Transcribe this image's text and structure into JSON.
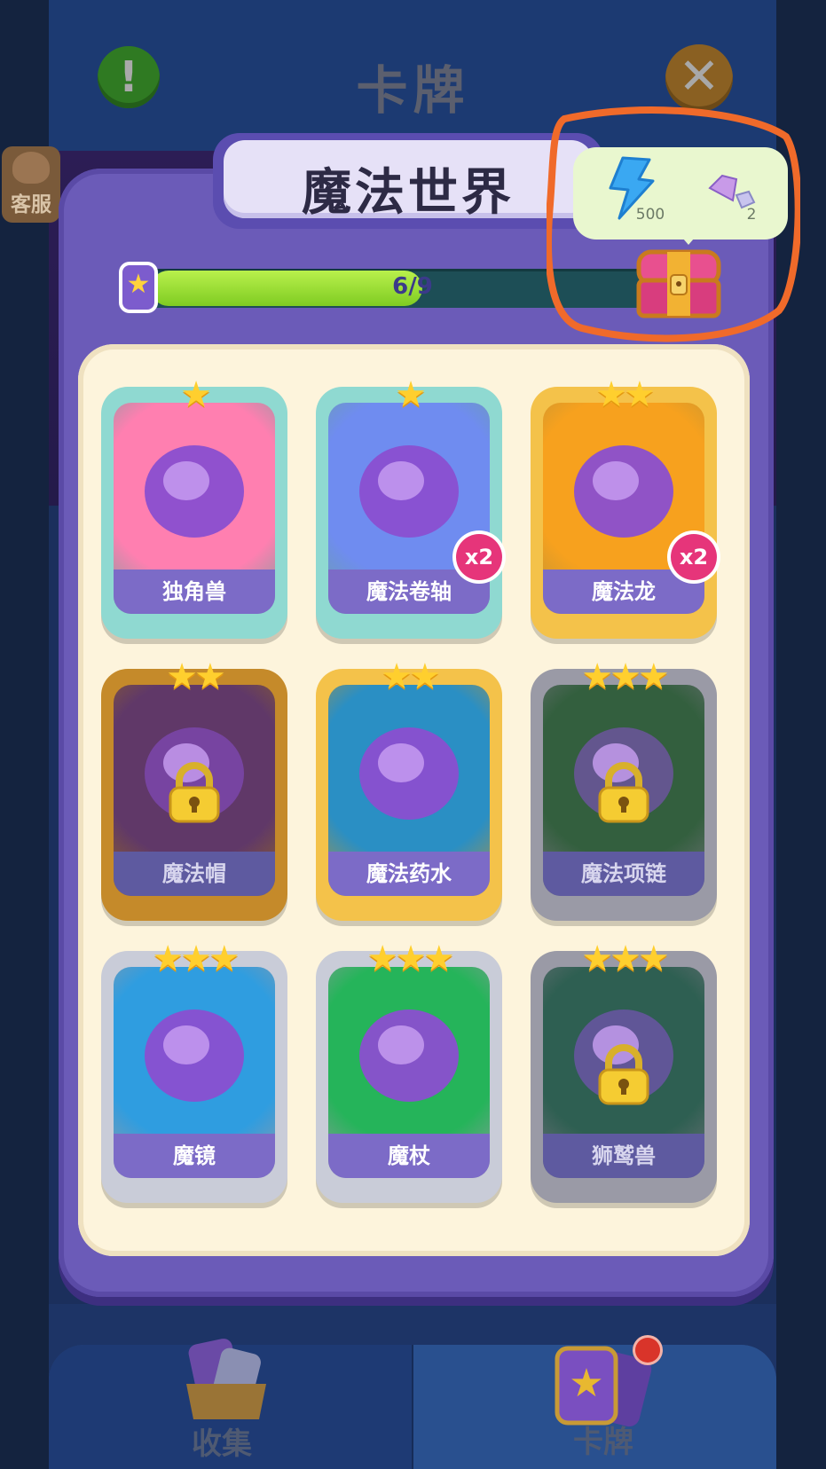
{
  "header": {
    "title": "卡牌",
    "info_icon": "!",
    "close_icon": "✕"
  },
  "customer_service": {
    "label": "客服"
  },
  "collection": {
    "title": "魔法世界"
  },
  "progress": {
    "text": "6/9",
    "fraction": 0.6667,
    "star_icon": "★"
  },
  "reward": {
    "energy_count": "500",
    "gem_count": "2"
  },
  "cards": [
    {
      "name": "独角兽",
      "stars": "★",
      "badge": "",
      "locked": false,
      "bg": "#ff7fb0",
      "frame": "#8fd9d1"
    },
    {
      "name": "魔法卷轴",
      "stars": "★",
      "badge": "x2",
      "locked": false,
      "bg": "#6f8cf0",
      "frame": "#8fd9d1"
    },
    {
      "name": "魔法龙",
      "stars": "★★",
      "badge": "x2",
      "locked": false,
      "bg": "#f7a11e",
      "frame": "#f4c24a"
    },
    {
      "name": "魔法帽",
      "stars": "★★",
      "badge": "",
      "locked": true,
      "bg": "#a64fb8",
      "frame": "#c58a2a"
    },
    {
      "name": "魔法药水",
      "stars": "★★",
      "badge": "",
      "locked": false,
      "bg": "#2a8fc4",
      "frame": "#f4c24a"
    },
    {
      "name": "魔法项链",
      "stars": "★★★",
      "badge": "",
      "locked": true,
      "bg": "#3a9a52",
      "frame": "#9a9aa6"
    },
    {
      "name": "魔镜",
      "stars": "★★★",
      "badge": "",
      "locked": false,
      "bg": "#2f9de0",
      "frame": "#c9ccd8"
    },
    {
      "name": "魔杖",
      "stars": "★★★",
      "badge": "",
      "locked": false,
      "bg": "#25b45a",
      "frame": "#c9ccd8"
    },
    {
      "name": "狮鹫兽",
      "stars": "★★★",
      "badge": "",
      "locked": true,
      "bg": "#2e9a7c",
      "frame": "#9a9aa6"
    }
  ],
  "bottom_nav": {
    "collect_label": "收集",
    "cards_label": "卡牌"
  },
  "colors": {
    "accent": "#6b5bb8",
    "progress": "#9be03a",
    "highlight": "#f06a2a"
  }
}
